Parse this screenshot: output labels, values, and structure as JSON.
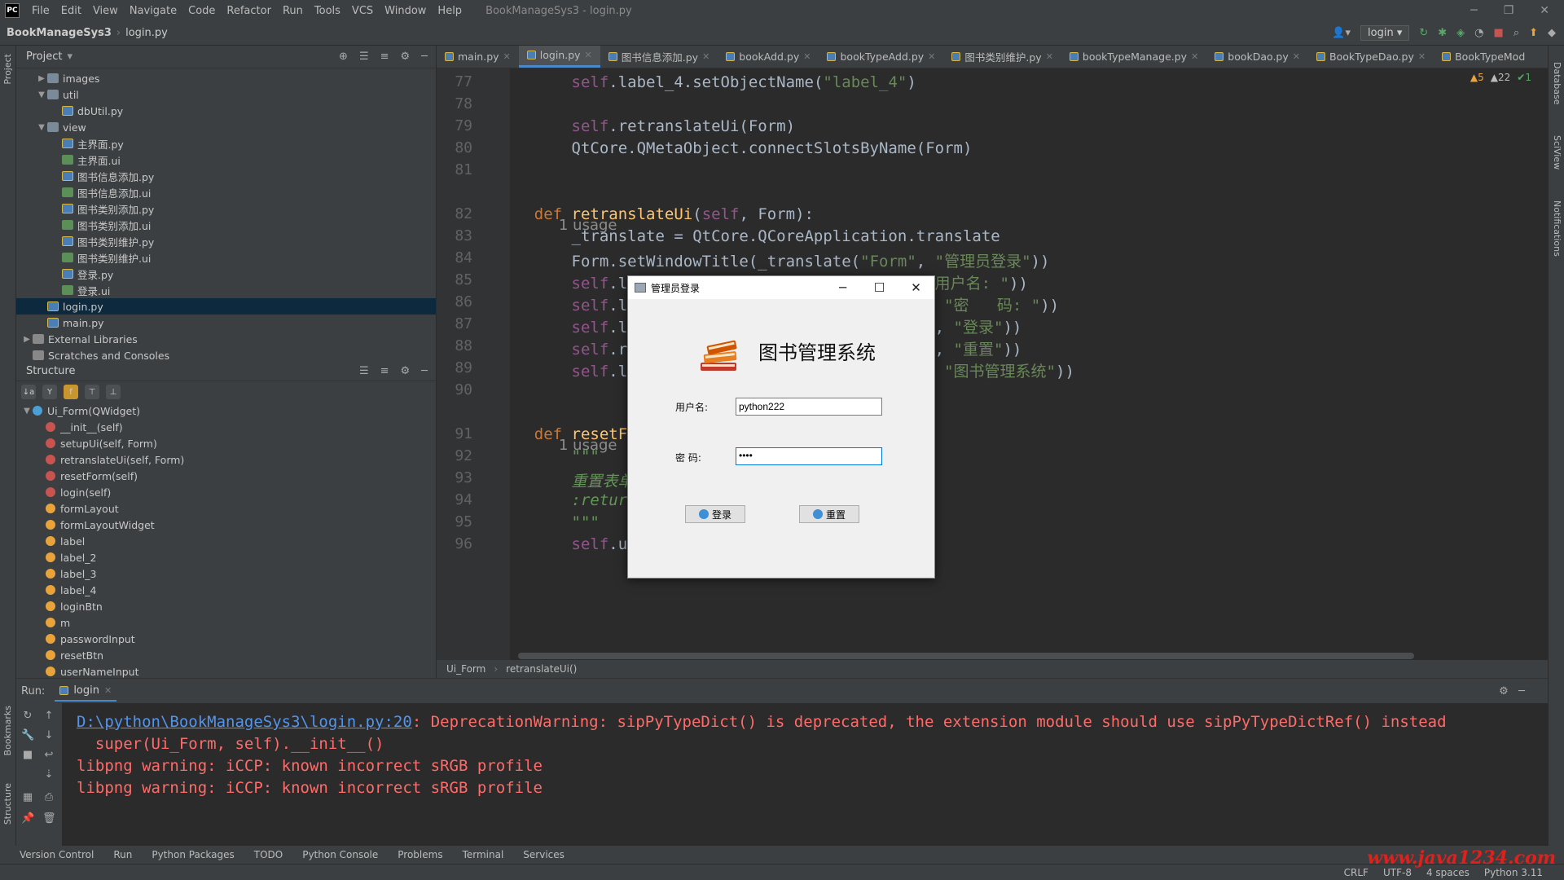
{
  "menubar": {
    "logo": "PC",
    "items": [
      "File",
      "Edit",
      "View",
      "Navigate",
      "Code",
      "Refactor",
      "Run",
      "Tools",
      "VCS",
      "Window",
      "Help"
    ],
    "window_title": "BookManageSys3 - login.py"
  },
  "navbar": {
    "project": "BookManageSys3",
    "file": "login.py",
    "run_config": "login"
  },
  "side_labels": {
    "project": "Project",
    "bookmarks": "Bookmarks",
    "structure": "Structure",
    "database": "Database",
    "sciview": "SciView",
    "notifications": "Notifications"
  },
  "project_panel": {
    "title": "Project",
    "tree": [
      {
        "label": "images",
        "type": "folder",
        "depth": 1,
        "arrow": "▶"
      },
      {
        "label": "util",
        "type": "folder",
        "depth": 1,
        "arrow": "▼"
      },
      {
        "label": "dbUtil.py",
        "type": "py",
        "depth": 2,
        "arrow": ""
      },
      {
        "label": "view",
        "type": "folder",
        "depth": 1,
        "arrow": "▼"
      },
      {
        "label": "主界面.py",
        "type": "py",
        "depth": 2,
        "arrow": ""
      },
      {
        "label": "主界面.ui",
        "type": "ui",
        "depth": 2,
        "arrow": ""
      },
      {
        "label": "图书信息添加.py",
        "type": "py",
        "depth": 2,
        "arrow": ""
      },
      {
        "label": "图书信息添加.ui",
        "type": "ui",
        "depth": 2,
        "arrow": ""
      },
      {
        "label": "图书类别添加.py",
        "type": "py",
        "depth": 2,
        "arrow": ""
      },
      {
        "label": "图书类别添加.ui",
        "type": "ui",
        "depth": 2,
        "arrow": ""
      },
      {
        "label": "图书类别维护.py",
        "type": "py",
        "depth": 2,
        "arrow": ""
      },
      {
        "label": "图书类别维护.ui",
        "type": "ui",
        "depth": 2,
        "arrow": ""
      },
      {
        "label": "登录.py",
        "type": "py",
        "depth": 2,
        "arrow": ""
      },
      {
        "label": "登录.ui",
        "type": "ui",
        "depth": 2,
        "arrow": ""
      },
      {
        "label": "login.py",
        "type": "py",
        "depth": 1,
        "arrow": "",
        "selected": true
      },
      {
        "label": "main.py",
        "type": "py",
        "depth": 1,
        "arrow": ""
      },
      {
        "label": "External Libraries",
        "type": "lib",
        "depth": 0,
        "arrow": "▶"
      },
      {
        "label": "Scratches and Consoles",
        "type": "lib",
        "depth": 0,
        "arrow": ""
      }
    ]
  },
  "structure_panel": {
    "title": "Structure",
    "items": [
      {
        "label": "Ui_Form(QWidget)",
        "kind": "c",
        "depth": 0
      },
      {
        "label": "__init__(self)",
        "kind": "m",
        "depth": 1
      },
      {
        "label": "setupUi(self, Form)",
        "kind": "m",
        "depth": 1
      },
      {
        "label": "retranslateUi(self, Form)",
        "kind": "m",
        "depth": 1
      },
      {
        "label": "resetForm(self)",
        "kind": "m",
        "depth": 1
      },
      {
        "label": "login(self)",
        "kind": "m",
        "depth": 1
      },
      {
        "label": "formLayout",
        "kind": "f",
        "depth": 1
      },
      {
        "label": "formLayoutWidget",
        "kind": "f",
        "depth": 1
      },
      {
        "label": "label",
        "kind": "f",
        "depth": 1
      },
      {
        "label": "label_2",
        "kind": "f",
        "depth": 1
      },
      {
        "label": "label_3",
        "kind": "f",
        "depth": 1
      },
      {
        "label": "label_4",
        "kind": "f",
        "depth": 1
      },
      {
        "label": "loginBtn",
        "kind": "f",
        "depth": 1
      },
      {
        "label": "m",
        "kind": "f",
        "depth": 1
      },
      {
        "label": "passwordInput",
        "kind": "f",
        "depth": 1
      },
      {
        "label": "resetBtn",
        "kind": "f",
        "depth": 1
      },
      {
        "label": "userNameInput",
        "kind": "f",
        "depth": 1
      }
    ]
  },
  "tabs": [
    "main.py",
    "login.py",
    "图书信息添加.py",
    "bookAdd.py",
    "bookTypeAdd.py",
    "图书类别维护.py",
    "bookTypeManage.py",
    "bookDao.py",
    "BookTypeDao.py",
    "BookTypeMod"
  ],
  "active_tab": 1,
  "editor": {
    "warnings": {
      "warn": "▲5",
      "weak": "▲22",
      "ok": "✔1"
    },
    "lines": [
      {
        "n": "77",
        "html": "        <span class='self'>self</span>.label_4.setObjectName(<span class='str'>\"label_4\"</span>)"
      },
      {
        "n": "78",
        "html": ""
      },
      {
        "n": "79",
        "html": "        <span class='self'>self</span>.retranslateUi(Form)"
      },
      {
        "n": "80",
        "html": "        QtCore.QMetaObject.connectSlotsByName(Form)"
      },
      {
        "n": "81",
        "html": ""
      },
      {
        "n": "82",
        "html": "    <span class='kw'>def</span> <span class='fn'>retranslateUi</span>(<span class='self'>self</span>, Form):"
      },
      {
        "n": "83",
        "html": "        _translate = QtCore.QCoreApplication.translate"
      },
      {
        "n": "84",
        "html": "        Form.setWindowTitle(_translate(<span class='str'>\"Form\"</span>, <span class='str'>\"管理员登录\"</span>))"
      },
      {
        "n": "85",
        "html": "        <span class='self'>self</span>.label.setText(_translate(<span class='str'>\"Form\"</span>, <span class='str'>\"用户名: \"</span>))"
      },
      {
        "n": "86",
        "html": "        <span class='self'>self</span>.label_2.setText(_translate(<span class='str'>\"Form\"</span>, <span class='str'>\"密   码: \"</span>))"
      },
      {
        "n": "87",
        "html": "        <span class='self'>self</span>.loginBtn.setText(_translate(<span class='str'>\"Form\"</span>, <span class='str'>\"登录\"</span>))"
      },
      {
        "n": "88",
        "html": "        <span class='self'>self</span>.resetBtn.setText(_translate(<span class='str'>\"Form\"</span>, <span class='str'>\"重置\"</span>))"
      },
      {
        "n": "89",
        "html": "        <span class='self'>self</span>.label_4.setText(_translate(<span class='str'>\"Form\"</span>, <span class='str'>\"图书管理系统\"</span>))"
      },
      {
        "n": "90",
        "html": ""
      },
      {
        "n": "91",
        "html": "    <span class='kw'>def</span> <span class='fn'>resetForm</span>(<span class='self'>self</span>):"
      },
      {
        "n": "92",
        "html": "        <span class='cm'>\"\"\"</span>"
      },
      {
        "n": "93",
        "html": "        <span class='cm'>重置表单</span>"
      },
      {
        "n": "94",
        "html": "        <span class='cm'>:return:</span>"
      },
      {
        "n": "95",
        "html": "        <span class='cm'>\"\"\"</span>"
      },
      {
        "n": "96",
        "html": "        <span class='self'>self</span>.userNameInput.setText(<span class='str'>\"\"</span>)"
      }
    ],
    "usage_label": "1 usage",
    "breadcrumb": [
      "Ui_Form",
      "retranslateUi()"
    ]
  },
  "run_panel": {
    "label": "Run:",
    "tab": "login",
    "lines": [
      {
        "link": "D:\\python\\BookManageSys3\\login.py:20",
        "text": ": DeprecationWarning: sipPyTypeDict() is deprecated, the extension module should use sipPyTypeDictRef() instead"
      },
      {
        "link": "",
        "text": "  super(Ui_Form, self).__init__()"
      },
      {
        "link": "",
        "text": "libpng warning: iCCP: known incorrect sRGB profile"
      },
      {
        "link": "",
        "text": "libpng warning: iCCP: known incorrect sRGB profile"
      }
    ]
  },
  "bottom_tools": [
    "Version Control",
    "Run",
    "Python Packages",
    "TODO",
    "Python Console",
    "Problems",
    "Terminal",
    "Services"
  ],
  "status": [
    "CRLF",
    "UTF-8",
    "4 spaces",
    "Python 3.11"
  ],
  "watermark": "www.java1234.com",
  "dialog": {
    "title": "管理员登录",
    "heading": "图书管理系统",
    "username_label": "用户名:",
    "username_value": "python222",
    "password_label": "密   码:",
    "password_value": "••••",
    "login_btn": "登录",
    "reset_btn": "重置"
  }
}
